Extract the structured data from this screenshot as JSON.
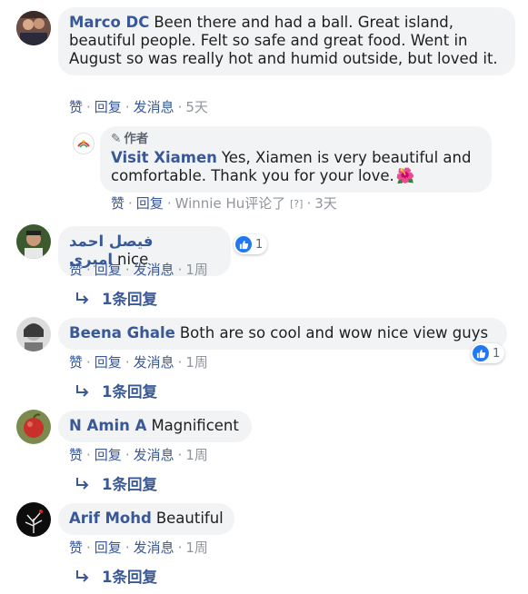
{
  "comments": [
    {
      "author": "Marco DC",
      "text": "Been there and had a ball. Great island, beautiful people. Felt so safe and great food. Went in August so was really hot and humid outside, but loved it.",
      "like": "赞",
      "reply": "回复",
      "message": "发消息",
      "time": "5天"
    },
    {
      "author": "فيصل احمد اميرى",
      "text": "nice",
      "like": "赞",
      "reply": "回复",
      "message": "发消息",
      "time": "1周",
      "reactions": "1",
      "replies": "1条回复"
    },
    {
      "author": "Beena Ghale",
      "text": "Both are so cool and wow nice view guys",
      "like": "赞",
      "reply": "回复",
      "message": "发消息",
      "time": "1周",
      "reactions": "1",
      "replies": "1条回复"
    },
    {
      "author": "N Amin A",
      "text": "Magnificent",
      "like": "赞",
      "reply": "回复",
      "message": "发消息",
      "time": "1周",
      "replies": "1条回复"
    },
    {
      "author": "Arif Mohd",
      "text": "Beautiful",
      "like": "赞",
      "reply": "回复",
      "message": "发消息",
      "time": "1周",
      "replies": "1条回复"
    }
  ],
  "page_reply": {
    "tag": "作者",
    "author": "Visit Xiamen",
    "text": "Yes, Xiamen is very beautiful and comfortable. Thank you for your love.",
    "emoji": "🌺",
    "like": "赞",
    "reply": "回复",
    "replied_by": "Winnie Hu评论了",
    "help": "[?]",
    "time": "3天"
  },
  "colors": {
    "link": "#385898",
    "bubble": "#f2f3f5",
    "meta": "#90949c",
    "like_blue": "#2078f4"
  }
}
